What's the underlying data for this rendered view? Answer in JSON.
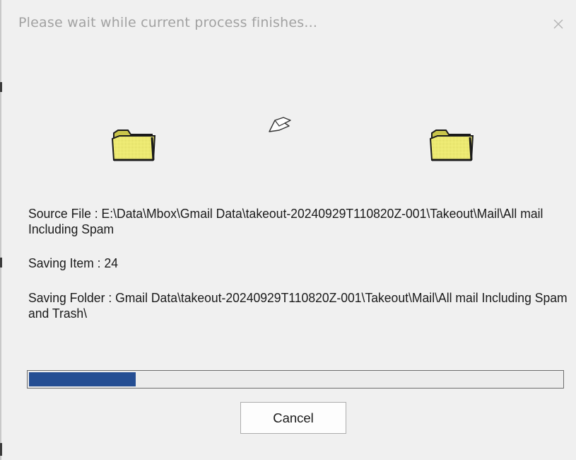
{
  "dialog": {
    "title": "Please wait while current process finishes...",
    "close_icon": "close-icon"
  },
  "animation": {
    "source_icon": "folder-icon",
    "flying_icon": "flying-document-icon",
    "destination_icon": "folder-icon"
  },
  "info": {
    "source_file": "Source File : E:\\Data\\Mbox\\Gmail Data\\takeout-20240929T110820Z-001\\Takeout\\Mail\\All mail Including Spam",
    "saving_item": "Saving Item : 24",
    "saving_folder": "Saving Folder : Gmail Data\\takeout-20240929T110820Z-001\\Takeout\\Mail\\All mail Including Spam and Trash\\"
  },
  "progress": {
    "fraction": 0.2
  },
  "buttons": {
    "cancel_label": "Cancel"
  },
  "colors": {
    "progress_fill": "#254e93",
    "folder_yellow": "#f3f07a",
    "title_text": "#a2a2a2"
  }
}
